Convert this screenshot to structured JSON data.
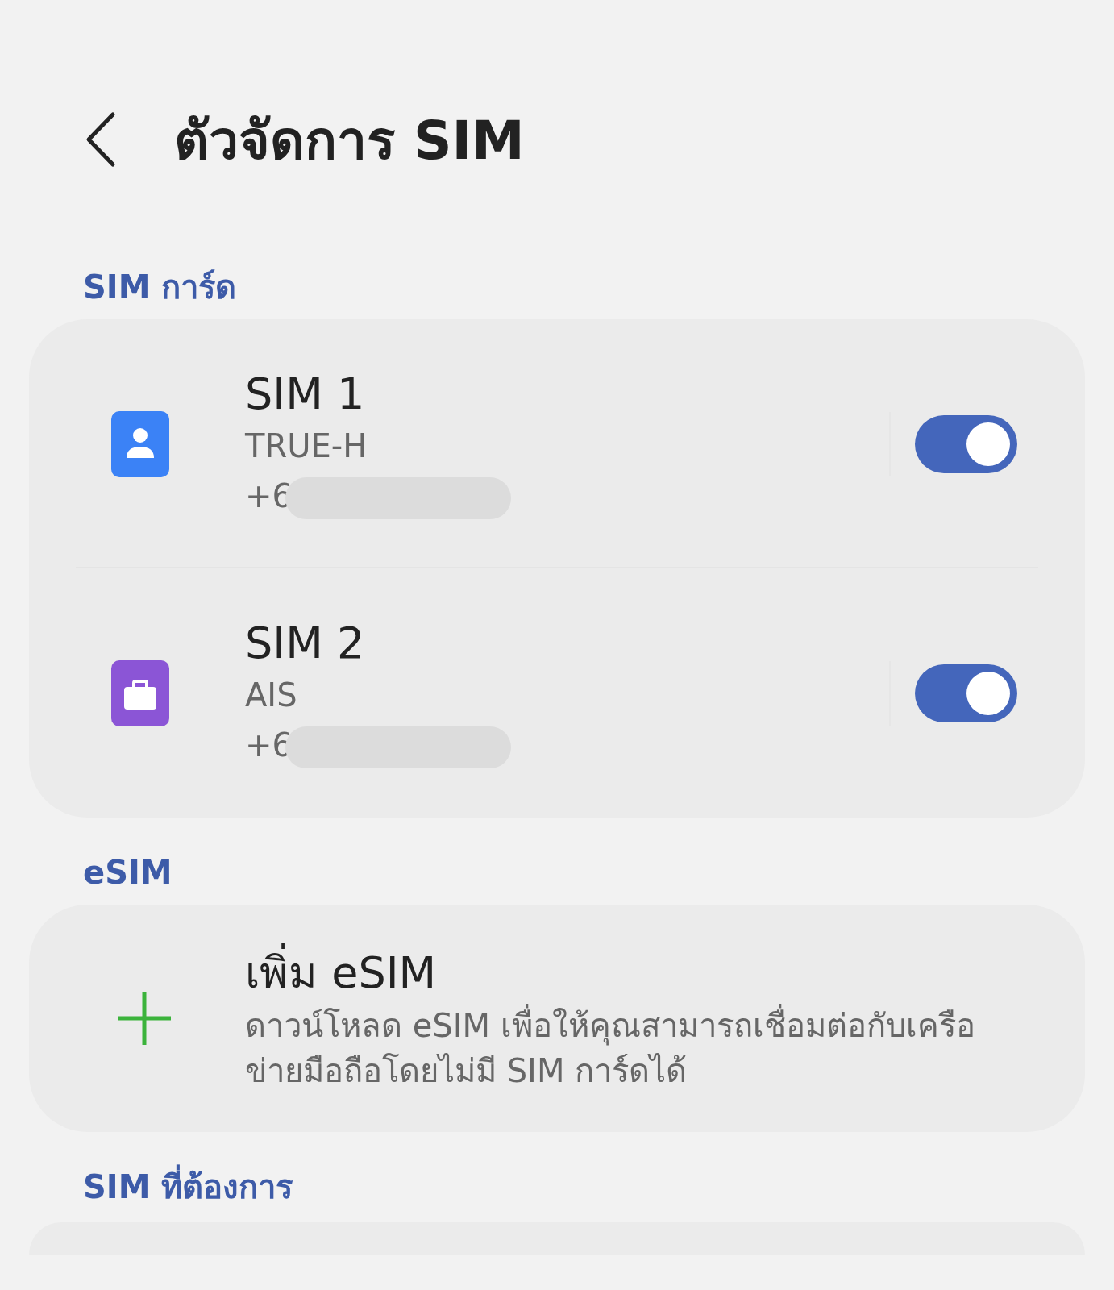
{
  "header": {
    "title": "ตัวจัดการ SIM"
  },
  "sim_section": {
    "label": "SIM การ์ด",
    "sims": [
      {
        "name": "SIM 1",
        "carrier": "TRUE-H",
        "number": "+6",
        "kind": "person",
        "color": "#3b82f6",
        "on": true
      },
      {
        "name": "SIM 2",
        "carrier": "AIS",
        "number": "+6",
        "kind": "briefcase",
        "color": "#8b55d6",
        "on": true
      }
    ]
  },
  "esim_section": {
    "label": "eSIM",
    "title": "เพิ่ม eSIM",
    "description": "ดาวน์โหลด eSIM เพื่อให้คุณสามารถเชื่อมต่อกับเครือข่ายมือถือโดยไม่มี SIM การ์ดได้"
  },
  "preferred_section": {
    "label": "SIM ที่ต้องการ"
  }
}
